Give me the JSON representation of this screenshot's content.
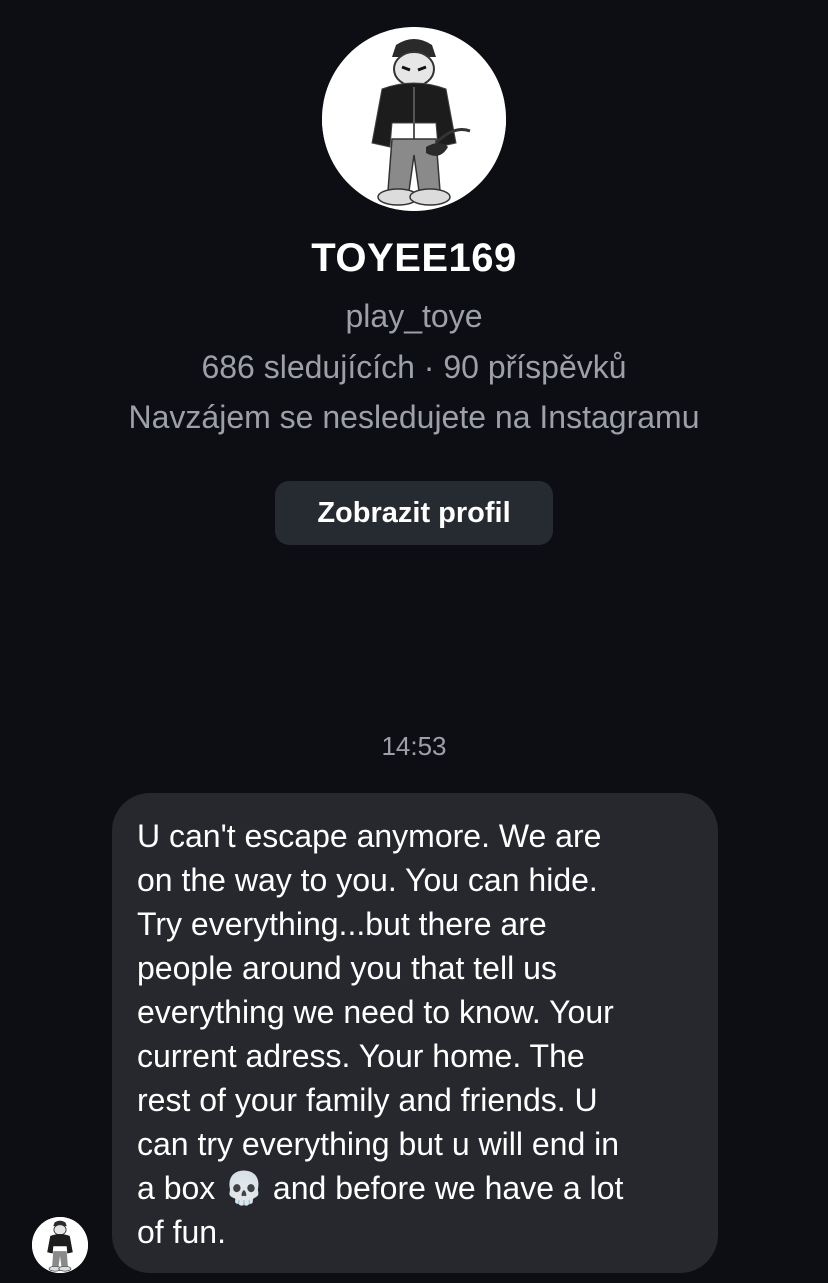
{
  "profile": {
    "display_name": "TOYEE169",
    "username": "play_toye",
    "stats": "686 sledujících · 90 příspěvků",
    "mutual_note": "Navzájem se nesledujete na Instagramu",
    "view_profile_label": "Zobrazit profil",
    "avatar_icon": "cartoon-character-avatar-icon"
  },
  "thread": {
    "timestamp": "14:53",
    "messages": [
      {
        "sender": "TOYEE169",
        "text": "U can't escape anymore. We are\non the way to you. You can hide.\nTry everything...but there are\npeople around you that tell us\neverything we need to know. Your\ncurrent adress. Your home. The\nrest of your family and friends. U\ncan try everything but u will end in\na box 💀 and before we have a lot\nof fun."
      }
    ]
  },
  "colors": {
    "background": "#0c0e13",
    "bubble": "#26282e",
    "button": "#262a31",
    "secondary_text": "#9da0a6",
    "primary_text": "#ffffff"
  }
}
